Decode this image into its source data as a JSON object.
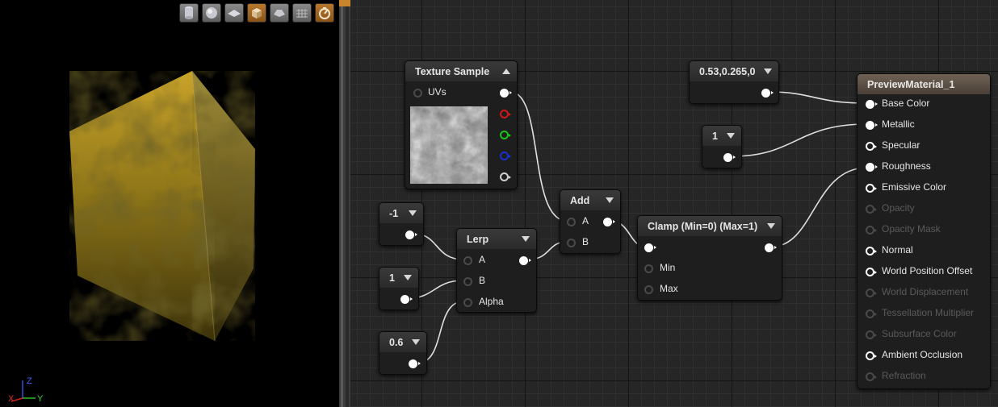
{
  "viewport": {
    "toolbar_buttons": [
      {
        "icon": "cylinder-preview-icon",
        "style": "grey"
      },
      {
        "icon": "sphere-preview-icon",
        "style": "grey"
      },
      {
        "icon": "plane-preview-icon",
        "style": "grey"
      },
      {
        "icon": "cube-preview-icon",
        "style": "orange"
      },
      {
        "icon": "custom-mesh-preview-icon",
        "style": "grey"
      },
      {
        "icon": "grid-toggle-icon",
        "style": "grey"
      },
      {
        "icon": "realtime-toggle-icon",
        "style": "orange"
      }
    ],
    "axis": {
      "z": "Z",
      "y": "Y",
      "x": "X"
    },
    "material_color": "#b38c1c"
  },
  "graph": {
    "texture_sample": {
      "title": "Texture Sample",
      "input_uvs": "UVs"
    },
    "const_color": {
      "title": "0.53,0.265,0"
    },
    "const_one_top": {
      "title": "1"
    },
    "const_neg1": {
      "title": "-1"
    },
    "const_one_mid": {
      "title": "1"
    },
    "const_06": {
      "title": "0.6"
    },
    "lerp": {
      "title": "Lerp",
      "a": "A",
      "b": "B",
      "alpha": "Alpha"
    },
    "add": {
      "title": "Add",
      "a": "A",
      "b": "B"
    },
    "clamp": {
      "title": "Clamp (Min=0) (Max=1)",
      "min": "Min",
      "max": "Max"
    },
    "material": {
      "title": "PreviewMaterial_1",
      "inputs": [
        {
          "label": "Base Color",
          "state": "connected"
        },
        {
          "label": "Metallic",
          "state": "connected"
        },
        {
          "label": "Specular",
          "state": "active"
        },
        {
          "label": "Roughness",
          "state": "connected"
        },
        {
          "label": "Emissive Color",
          "state": "active"
        },
        {
          "label": "Opacity",
          "state": "disabled"
        },
        {
          "label": "Opacity Mask",
          "state": "disabled"
        },
        {
          "label": "Normal",
          "state": "active"
        },
        {
          "label": "World Position Offset",
          "state": "active"
        },
        {
          "label": "World Displacement",
          "state": "disabled"
        },
        {
          "label": "Tessellation Multiplier",
          "state": "disabled"
        },
        {
          "label": "Subsurface Color",
          "state": "disabled"
        },
        {
          "label": "Ambient Occlusion",
          "state": "active"
        },
        {
          "label": "Refraction",
          "state": "disabled"
        }
      ]
    },
    "pin_colors": {
      "red": "#d21818",
      "green": "#18c418",
      "blue": "#1830d2",
      "alpha": "#cfcfcf"
    }
  }
}
